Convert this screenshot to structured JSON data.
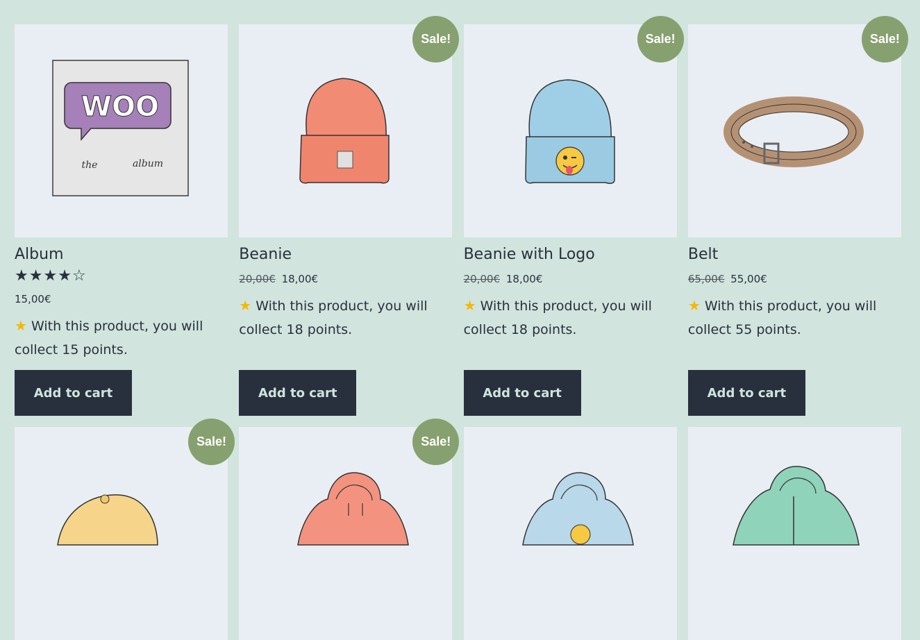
{
  "products": [
    {
      "name": "Album",
      "sale": "",
      "rating_icons": [
        "★",
        "★",
        "★",
        "★",
        "☆"
      ],
      "old_price": "",
      "price": "15,00€",
      "points_text": "With this product, you will collect 15 points.",
      "button": "Add to cart",
      "image": "album-image"
    },
    {
      "name": "Beanie",
      "sale": "Sale!",
      "old_price": "20,00€",
      "price": "18,00€",
      "points_text": "With this product, you will collect 18 points.",
      "button": "Add to cart",
      "image": "beanie-image"
    },
    {
      "name": "Beanie with Logo",
      "sale": "Sale!",
      "old_price": "20,00€",
      "price": "18,00€",
      "points_text": "With this product, you will collect 18 points.",
      "button": "Add to cart",
      "image": "beanie-logo-image"
    },
    {
      "name": "Belt",
      "sale": "Sale!",
      "old_price": "65,00€",
      "price": "55,00€",
      "points_text": "With this product, you will collect 55 points.",
      "button": "Add to cart",
      "image": "belt-image"
    },
    {
      "sale": "Sale!",
      "image": "cap-image"
    },
    {
      "sale": "Sale!",
      "image": "hoodie-image"
    },
    {
      "sale": "",
      "image": "hoodie-logo-image"
    },
    {
      "sale": "",
      "image": "hoodie-zipper-image"
    }
  ],
  "album_art": {
    "logo": "WOO",
    "left": "the",
    "right": "album"
  },
  "colors": {
    "background": "#d1e4dd",
    "button": "#28303d",
    "sale_badge": "#87a06f",
    "card": "#e9eef4"
  }
}
